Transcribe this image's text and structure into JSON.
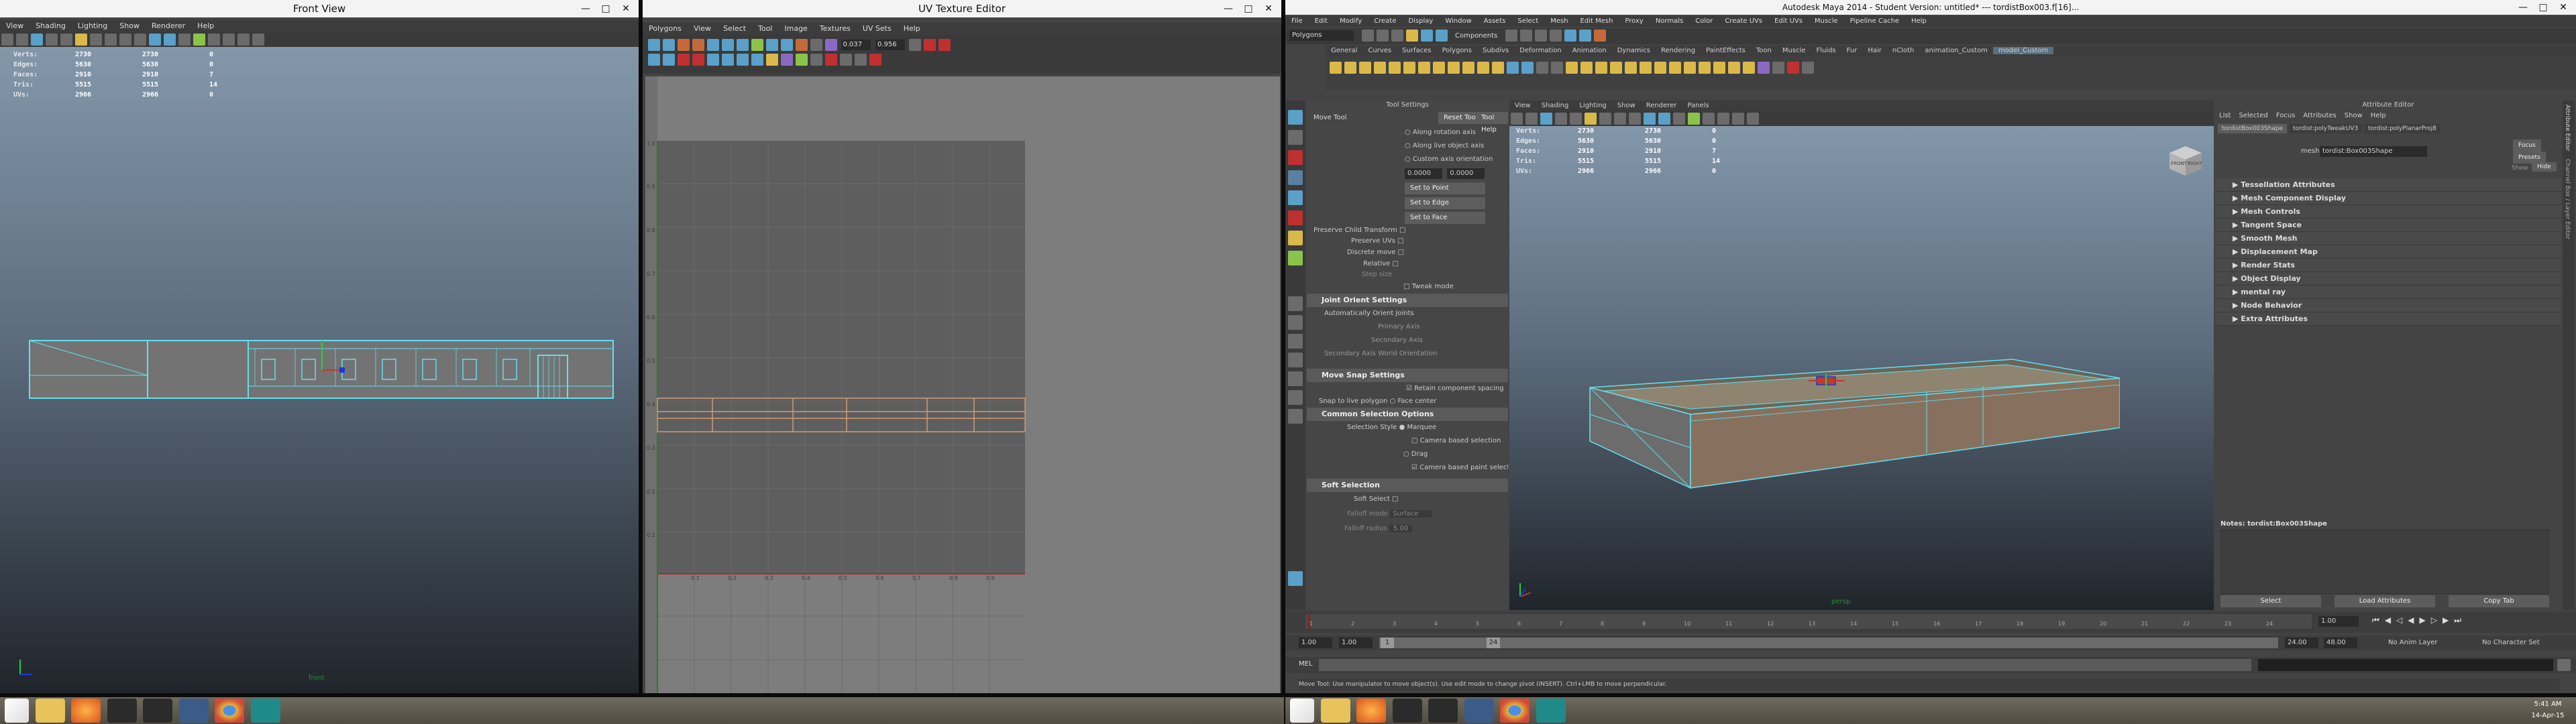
{
  "front_view": {
    "title": "Front View",
    "menu": [
      "View",
      "Shading",
      "Lighting",
      "Show",
      "Renderer",
      "Help"
    ],
    "hud": [
      {
        "label": "Verts:",
        "a": "2730",
        "b": "2730",
        "c": "0"
      },
      {
        "label": "Edges:",
        "a": "5630",
        "b": "5630",
        "c": "0"
      },
      {
        "label": "Faces:",
        "a": "2910",
        "b": "2910",
        "c": "7"
      },
      {
        "label": "Tris:",
        "a": "5515",
        "b": "5515",
        "c": "14"
      },
      {
        "label": "UVs:",
        "a": "2966",
        "b": "2966",
        "c": "0"
      }
    ],
    "camera_label": "front"
  },
  "uv_editor": {
    "title": "UV Texture Editor",
    "menu": [
      "Polygons",
      "View",
      "Select",
      "Tool",
      "Image",
      "Textures",
      "UV Sets",
      "Help"
    ],
    "field1": "0.037",
    "field2": "0.956",
    "ticks_x": [
      "0.1",
      "0.2",
      "0.3",
      "0.4",
      "0.5",
      "0.6",
      "0.7",
      "0.8",
      "0.9"
    ],
    "ticks_y": [
      "1.0",
      "0.9",
      "0.8",
      "0.7",
      "0.6",
      "0.5",
      "0.4",
      "0.3",
      "0.2",
      "0.1"
    ]
  },
  "maya": {
    "title": "Autodesk Maya 2014 - Student Version: untitled*   ---   tordistBox003.f[16]...",
    "menu": [
      "File",
      "Edit",
      "Modify",
      "Create",
      "Display",
      "Window",
      "Assets",
      "Select",
      "Mesh",
      "Edit Mesh",
      "Proxy",
      "Normals",
      "Color",
      "Create UVs",
      "Edit UVs",
      "Muscle",
      "Pipeline Cache",
      "Help"
    ],
    "mode_select": "Polygons",
    "components_label": "Components",
    "shelf_tabs": [
      "General",
      "Curves",
      "Surfaces",
      "Polygons",
      "Subdivs",
      "Deformation",
      "Animation",
      "Dynamics",
      "Rendering",
      "PaintEffects",
      "Toon",
      "Muscle",
      "Fluids",
      "Fur",
      "Hair",
      "nCloth",
      "animation_Custom",
      "model_Custom"
    ],
    "tool_settings": {
      "header": "Tool Settings",
      "tool_name": "Move Tool",
      "reset_btn": "Reset Tool",
      "help_btn": "Tool Help",
      "options": [
        "Along rotation axis",
        "Along live object axis",
        "Custom axis orientation"
      ],
      "values": [
        "0.0000",
        "0.0000"
      ],
      "set_btns": [
        "Set to Point",
        "Set to Edge",
        "Set to Face"
      ],
      "preserve_child": "Preserve Child Transform",
      "preserve_uvs": "Preserve UVs",
      "discrete_move": "Discrete move",
      "relative": "Relative",
      "step_size": "Step size",
      "tweak_mode": "Tweak mode",
      "joint_orient": "Joint Orient Settings",
      "auto_orient": "Automatically Orient Joints",
      "primary_axis": "Primary Axis",
      "secondary_axis": "Secondary Axis",
      "secondary_world": "Secondary Axis World Orientation",
      "move_snap": "Move Snap Settings",
      "retain_component": "Retain component spacing",
      "snap_live": "Snap to live polygon",
      "face_center": "Face center",
      "common_sel": "Common Selection Options",
      "selection_style": "Selection Style",
      "marquee": "Marquee",
      "camera_based": "Camera based selection",
      "drag": "Drag",
      "camera_based2": "Camera based paint selection",
      "soft_sel": "Soft Selection",
      "soft_select": "Soft Select",
      "falloff_mode": "Falloff mode",
      "falloff_mode_val": "Surface",
      "falloff_radius": "Falloff radius",
      "falloff_radius_val": "5.00"
    },
    "viewport": {
      "menu": [
        "View",
        "Shading",
        "Lighting",
        "Show",
        "Renderer",
        "Panels"
      ],
      "hud": [
        {
          "label": "Verts:",
          "a": "2730",
          "b": "2730",
          "c": "0"
        },
        {
          "label": "Edges:",
          "a": "5630",
          "b": "5630",
          "c": "0"
        },
        {
          "label": "Faces:",
          "a": "2910",
          "b": "2910",
          "c": "7"
        },
        {
          "label": "Tris:",
          "a": "5515",
          "b": "5515",
          "c": "14"
        },
        {
          "label": "UVs:",
          "a": "2966",
          "b": "2966",
          "c": "0"
        }
      ],
      "cube_front": "FRONT",
      "cube_right": "RIGHT",
      "camera_label": "persp"
    },
    "attribute_editor": {
      "header": "Attribute Editor",
      "menu": [
        "List",
        "Selected",
        "Focus",
        "Attributes",
        "Show",
        "Help"
      ],
      "tabs": [
        "tordistBox003Shape",
        "tordist:polyTweakUV3",
        "tordist:polyPlanarProj8"
      ],
      "mesh_label": "mesh:",
      "mesh_value": "tordist:Box003Shape",
      "focus_btn": "Focus",
      "presets_btn": "Presets",
      "show_btn": "Show",
      "hide_btn": "Hide",
      "sections": [
        "Tessellation Attributes",
        "Mesh Component Display",
        "Mesh Controls",
        "Tangent Space",
        "Smooth Mesh",
        "Displacement Map",
        "Render Stats",
        "Object Display",
        "mental ray",
        "Node Behavior",
        "Extra Attributes"
      ],
      "notes": "Notes: tordist:Box003Shape",
      "select_btn": "Select",
      "load_btn": "Load Attributes",
      "copy_btn": "Copy Tab",
      "side_tabs": [
        "Attribute Editor",
        "Channel Box / Layer Editor"
      ]
    },
    "timeline": {
      "ticks": [
        "1",
        "2",
        "3",
        "4",
        "5",
        "6",
        "7",
        "8",
        "9",
        "10",
        "11",
        "12",
        "13",
        "14",
        "15",
        "16",
        "17",
        "18",
        "19",
        "20",
        "21",
        "22",
        "23",
        "24"
      ],
      "current": "1.00"
    },
    "range": {
      "start": "1.00",
      "start2": "1.00",
      "range_start": "1",
      "range_end": "24",
      "end": "24.00",
      "end2": "48.00",
      "anim_layer": "No Anim Layer",
      "char_set": "No Character Set"
    },
    "mel_label": "MEL",
    "help_line": "Move Tool: Use manipulator to move object(s). Use edit mode to change pivot (INSERT). Ctrl+LMB to move perpendicular."
  },
  "taskbar": {
    "clock": "5:41 AM",
    "date": "14-Apr-15"
  },
  "colors": {
    "wire": "#62e0f0",
    "uv_orange": "#d49a72",
    "mesh_brown": "#87715e",
    "sel_red": "#c0392b"
  }
}
